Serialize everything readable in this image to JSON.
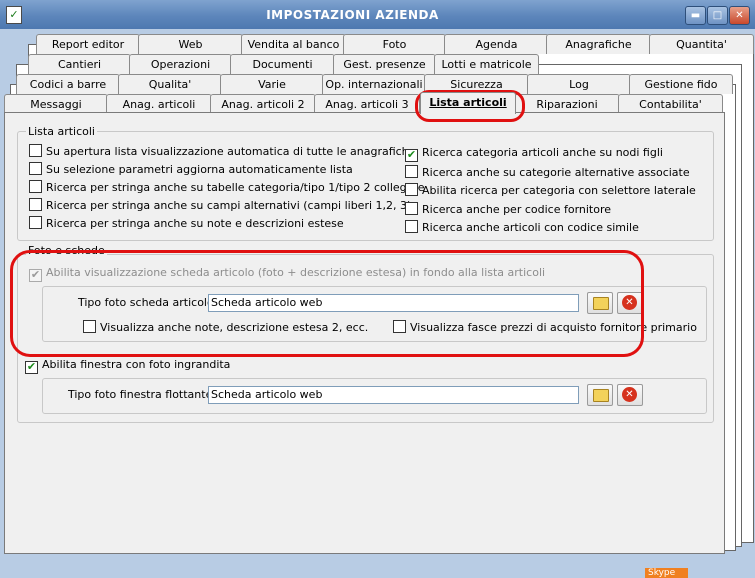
{
  "window": {
    "title": "IMPOSTAZIONI AZIENDA",
    "minimize": "▬",
    "maximize": "□",
    "close": "✕"
  },
  "tabs_row1": [
    "Report editor",
    "Web",
    "Vendita al banco",
    "Foto",
    "Agenda",
    "Anagrafiche",
    "Quantita'"
  ],
  "tabs_row2": [
    "Cantieri",
    "Operazioni",
    "Documenti",
    "Gest. presenze",
    "Lotti e matricole"
  ],
  "tabs_row3": [
    "Codici a barre",
    "Qualita'",
    "Varie",
    "Op. internazionali",
    "Sicurezza",
    "Log",
    "Gestione fido"
  ],
  "tabs_row4": [
    "Messaggi",
    "Anag. articoli",
    "Anag. articoli 2",
    "Anag. articoli 3",
    "Lista articoli",
    "Riparazioni",
    "Contabilita'"
  ],
  "lista_articoli": {
    "title": "Lista articoli",
    "left": [
      {
        "label": "Su apertura lista visualizzazione automatica di tutte le anagrafiche",
        "checked": false
      },
      {
        "label": "Su selezione parametri aggiorna automaticamente lista",
        "checked": false
      },
      {
        "label": "Ricerca per stringa anche su tabelle categoria/tipo 1/tipo 2 collegate",
        "checked": false
      },
      {
        "label": "Ricerca per stringa anche su campi alternativi (campi liberi 1,2, 3)",
        "checked": false
      },
      {
        "label": "Ricerca per stringa anche su note e descrizioni estese",
        "checked": false
      }
    ],
    "right": [
      {
        "label": "Ricerca categoria articoli anche su nodi figli",
        "checked": true
      },
      {
        "label": "Ricerca anche su categorie alternative associate",
        "checked": false
      },
      {
        "label": "Abilita ricerca per categoria con selettore laterale",
        "checked": false
      },
      {
        "label": "Ricerca anche per codice fornitore",
        "checked": false
      },
      {
        "label": "Ricerca anche articoli con codice simile",
        "checked": false
      }
    ]
  },
  "foto_schede": {
    "title": "Foto e schede",
    "abilita_scheda": {
      "label": "Abilita visualizzazione scheda articolo (foto + descrizione estesa) in fondo alla lista articoli",
      "checked": true
    },
    "tipo_foto_label": "Tipo foto scheda articolo :",
    "tipo_foto_value": "Scheda articolo web",
    "visualizza_note": {
      "label": "Visualizza anche note, descrizione estesa 2, ecc.",
      "checked": false
    },
    "visualizza_fasce": {
      "label": "Visualizza fasce prezzi di acquisto fornitore primario",
      "checked": false
    },
    "abilita_finestra": {
      "label": "Abilita finestra con foto ingrandita",
      "checked": true
    },
    "tipo_finestra_label": "Tipo foto finestra flottante :",
    "tipo_finestra_value": "Scheda articolo web"
  },
  "icons": {
    "folder": "folder-icon",
    "clear": "clear-icon",
    "check": "✔"
  },
  "colors": {
    "titlebar": "#5d86bb",
    "highlight": "#e01010",
    "check": "#1a8a1a"
  },
  "status": {
    "skype": "Skype"
  }
}
